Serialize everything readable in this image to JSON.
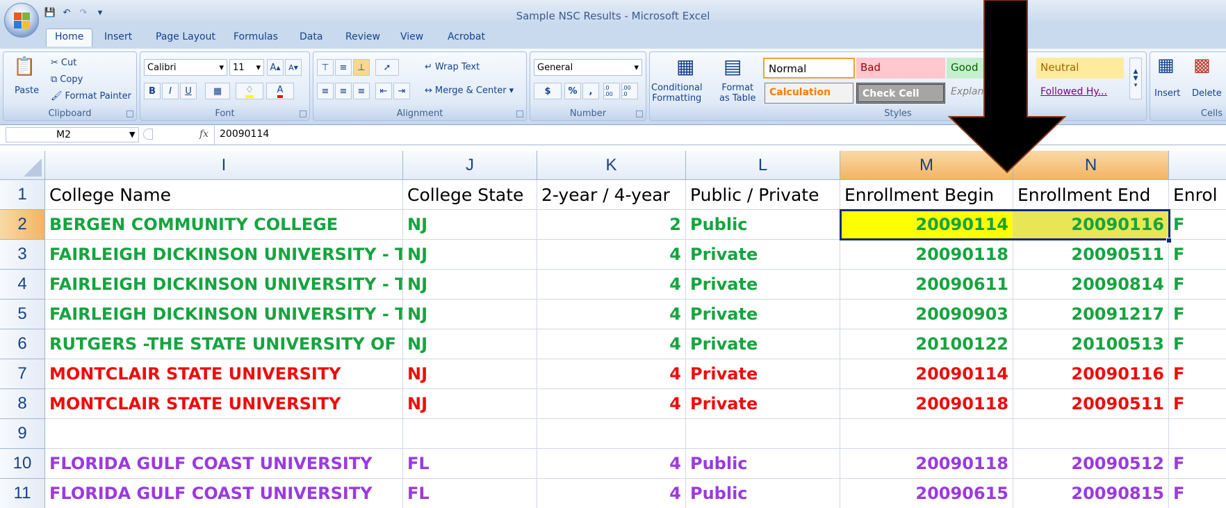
{
  "window": {
    "title": "Sample NSC Results - Microsoft Excel"
  },
  "tabs": [
    "Home",
    "Insert",
    "Page Layout",
    "Formulas",
    "Data",
    "Review",
    "View",
    "Acrobat"
  ],
  "ribbon": {
    "clipboard": {
      "label": "Clipboard",
      "paste": "Paste",
      "cut": "Cut",
      "copy": "Copy",
      "format_painter": "Format Painter"
    },
    "font": {
      "label": "Font",
      "family": "Calibri",
      "size": "11",
      "bold": "B",
      "italic": "I",
      "underline": "U"
    },
    "alignment": {
      "label": "Alignment",
      "wrap_text": "Wrap Text",
      "merge_center": "Merge & Center"
    },
    "number": {
      "label": "Number",
      "format": "General",
      "currency": "$",
      "percent": "%",
      "comma": ",",
      "inc_dec": ".0 .00",
      "dec_dec": ".00 .0"
    },
    "styles": {
      "label": "Styles",
      "conditional": "Conditional",
      "formatting": "Formatting",
      "format": "Format",
      "as_table": "as Table",
      "cells": [
        {
          "name": "Normal"
        },
        {
          "name": "Bad"
        },
        {
          "name": "Good"
        },
        {
          "name": "Neutral"
        },
        {
          "name": "Calculation"
        },
        {
          "name": "Check Cell"
        },
        {
          "name": "Explanatory..."
        },
        {
          "name": "Followed Hy..."
        }
      ]
    },
    "cells": {
      "label": "Cells",
      "insert": "Insert",
      "delete": "Delete"
    }
  },
  "formula_bar": {
    "name_box": "M2",
    "fx": "fx",
    "value": "20090114"
  },
  "columns": [
    "I",
    "J",
    "K",
    "L",
    "M",
    "N"
  ],
  "row_numbers": [
    "1",
    "2",
    "3",
    "4",
    "5",
    "6",
    "7",
    "8",
    "9",
    "10",
    "11"
  ],
  "header_row": [
    "College Name",
    "College State",
    "2-year / 4-year",
    "Public / Private",
    "Enrollment Begin",
    "Enrollment End",
    "Enrol"
  ],
  "rows": [
    {
      "color": "green",
      "cells": [
        "BERGEN COMMUNITY COLLEGE",
        "NJ",
        "2",
        "Public",
        "20090114",
        "20090116",
        "F"
      ]
    },
    {
      "color": "green",
      "cells": [
        "FAIRLEIGH DICKINSON UNIVERSITY - T",
        "NJ",
        "4",
        "Private",
        "20090118",
        "20090511",
        "F"
      ]
    },
    {
      "color": "green",
      "cells": [
        "FAIRLEIGH DICKINSON UNIVERSITY - T",
        "NJ",
        "4",
        "Private",
        "20090611",
        "20090814",
        "F"
      ]
    },
    {
      "color": "green",
      "cells": [
        "FAIRLEIGH DICKINSON UNIVERSITY - T",
        "NJ",
        "4",
        "Private",
        "20090903",
        "20091217",
        "F"
      ]
    },
    {
      "color": "green",
      "cells": [
        "RUTGERS -THE STATE UNIVERSITY OF",
        "NJ",
        "4",
        "Private",
        "20100122",
        "20100513",
        "F"
      ]
    },
    {
      "color": "red",
      "cells": [
        "MONTCLAIR STATE UNIVERSITY",
        "NJ",
        "4",
        "Private",
        "20090114",
        "20090116",
        "F"
      ]
    },
    {
      "color": "red",
      "cells": [
        "MONTCLAIR STATE UNIVERSITY",
        "NJ",
        "4",
        "Private",
        "20090118",
        "20090511",
        "F"
      ]
    },
    {
      "color": "none",
      "cells": [
        "",
        "",
        "",
        "",
        "",
        "",
        ""
      ]
    },
    {
      "color": "purple",
      "cells": [
        "FLORIDA GULF COAST UNIVERSITY",
        "FL",
        "4",
        "Public",
        "20090118",
        "20090512",
        "F"
      ]
    },
    {
      "color": "purple",
      "cells": [
        "FLORIDA GULF COAST UNIVERSITY",
        "FL",
        "4",
        "Public",
        "20090615",
        "20090815",
        "F"
      ]
    }
  ],
  "selection": {
    "range": "M2:N2",
    "highlight_color": "#ffff00"
  },
  "colors": {
    "green": "#15a43f",
    "red": "#ee0c0c",
    "purple": "#9a3ae0",
    "selected_header": "#f8c67f"
  }
}
